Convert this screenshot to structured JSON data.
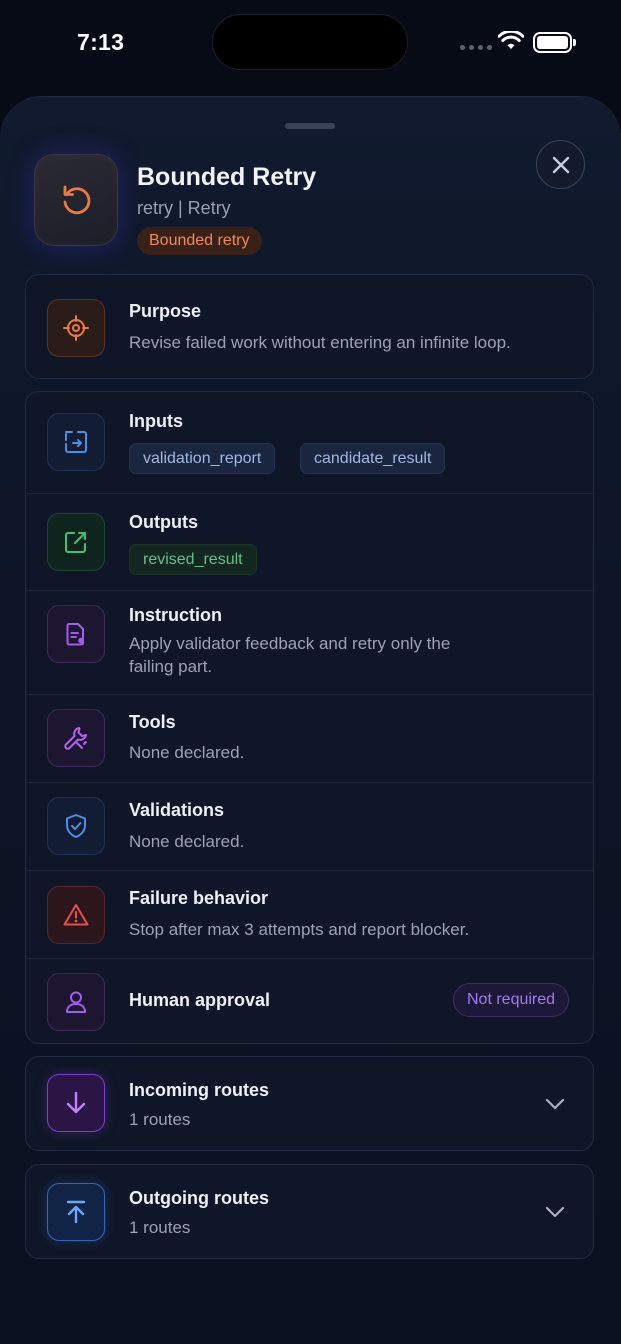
{
  "status_bar": {
    "time": "7:13"
  },
  "header": {
    "title": "Bounded Retry",
    "subtitle": "retry | Retry",
    "badge": "Bounded retry",
    "icon": "retry-icon"
  },
  "purpose": {
    "title": "Purpose",
    "text": "Revise failed work without entering an infinite loop.",
    "icon": "target-icon"
  },
  "details": {
    "inputs": {
      "title": "Inputs",
      "chips": [
        "validation_report",
        "candidate_result"
      ],
      "icon": "input-icon"
    },
    "outputs": {
      "title": "Outputs",
      "chips": [
        "revised_result"
      ],
      "icon": "external-link-icon"
    },
    "instruction": {
      "title": "Instruction",
      "text_line1": "Apply validator feedback and retry only the",
      "text_line2": "failing part.",
      "icon": "document-icon"
    },
    "tools": {
      "title": "Tools",
      "text": "None declared.",
      "icon": "wrench-icon"
    },
    "validations": {
      "title": "Validations",
      "text": "None declared.",
      "icon": "shield-check-icon"
    },
    "failure": {
      "title": "Failure behavior",
      "text": "Stop after max 3 attempts and report blocker.",
      "icon": "warning-icon"
    },
    "approval": {
      "title": "Human approval",
      "badge": "Not required",
      "icon": "user-icon"
    }
  },
  "incoming": {
    "title": "Incoming routes",
    "count": "1 routes",
    "icon": "arrow-down-icon"
  },
  "outgoing": {
    "title": "Outgoing routes",
    "count": "1 routes",
    "icon": "upload-icon"
  },
  "colors": {
    "accent_orange": "#f07a3a",
    "accent_blue": "#4a90e8",
    "accent_green": "#3fbf78",
    "accent_purple": "#a35cf0",
    "accent_red": "#e8504a",
    "background": "#070b16"
  }
}
